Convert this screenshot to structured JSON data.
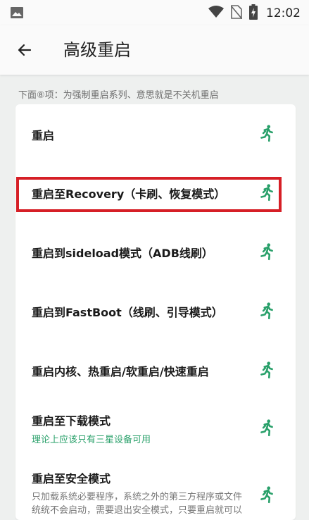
{
  "status": {
    "time": "12:02",
    "icons": [
      "image-icon",
      "wifi-icon",
      "no-sim-icon",
      "battery-charging-icon"
    ]
  },
  "app_bar": {
    "title": "高级重启",
    "back_icon": "arrow-left-icon"
  },
  "hint": "下面⑧项：为强制重启系列、意思就是不关机重启",
  "items": [
    {
      "title": "重启",
      "icon": "running-person-icon"
    },
    {
      "title": "重启至Recovery（卡刷、恢复模式）",
      "icon": "running-person-icon"
    },
    {
      "title": "重启到sideload模式（ADB线刷）",
      "icon": "running-person-icon"
    },
    {
      "title": "重启到FastBoot（线刷、引导模式）",
      "icon": "running-person-icon"
    },
    {
      "title": "重启内核、热重启/软重启/快速重启",
      "icon": "running-person-icon"
    },
    {
      "title": "重启至下载模式",
      "subtitle": "理论上应该只有三星设备可用",
      "icon": "running-person-icon"
    },
    {
      "title": "重启至安全模式",
      "subtitle_lines": [
        "只加载系统必要程序，系统之外的第三方程序或文件",
        "统统不会启动，需要退出安全模式，只要重启就可以"
      ],
      "icon": "running-person-icon"
    }
  ],
  "colors": {
    "accent_green": "#29a06a",
    "highlight_red": "#d61f26",
    "background": "#eef0ef"
  }
}
